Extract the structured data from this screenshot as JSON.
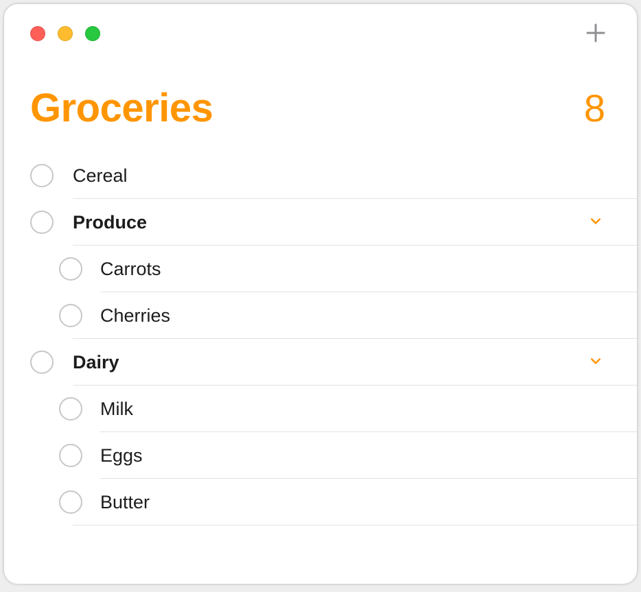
{
  "colors": {
    "accent": "#FF9500"
  },
  "header": {
    "title": "Groceries",
    "count": "8"
  },
  "items": [
    {
      "label": "Cereal"
    },
    {
      "label": "Produce"
    },
    {
      "label": "Carrots"
    },
    {
      "label": "Cherries"
    },
    {
      "label": "Dairy"
    },
    {
      "label": "Milk"
    },
    {
      "label": "Eggs"
    },
    {
      "label": "Butter"
    }
  ]
}
